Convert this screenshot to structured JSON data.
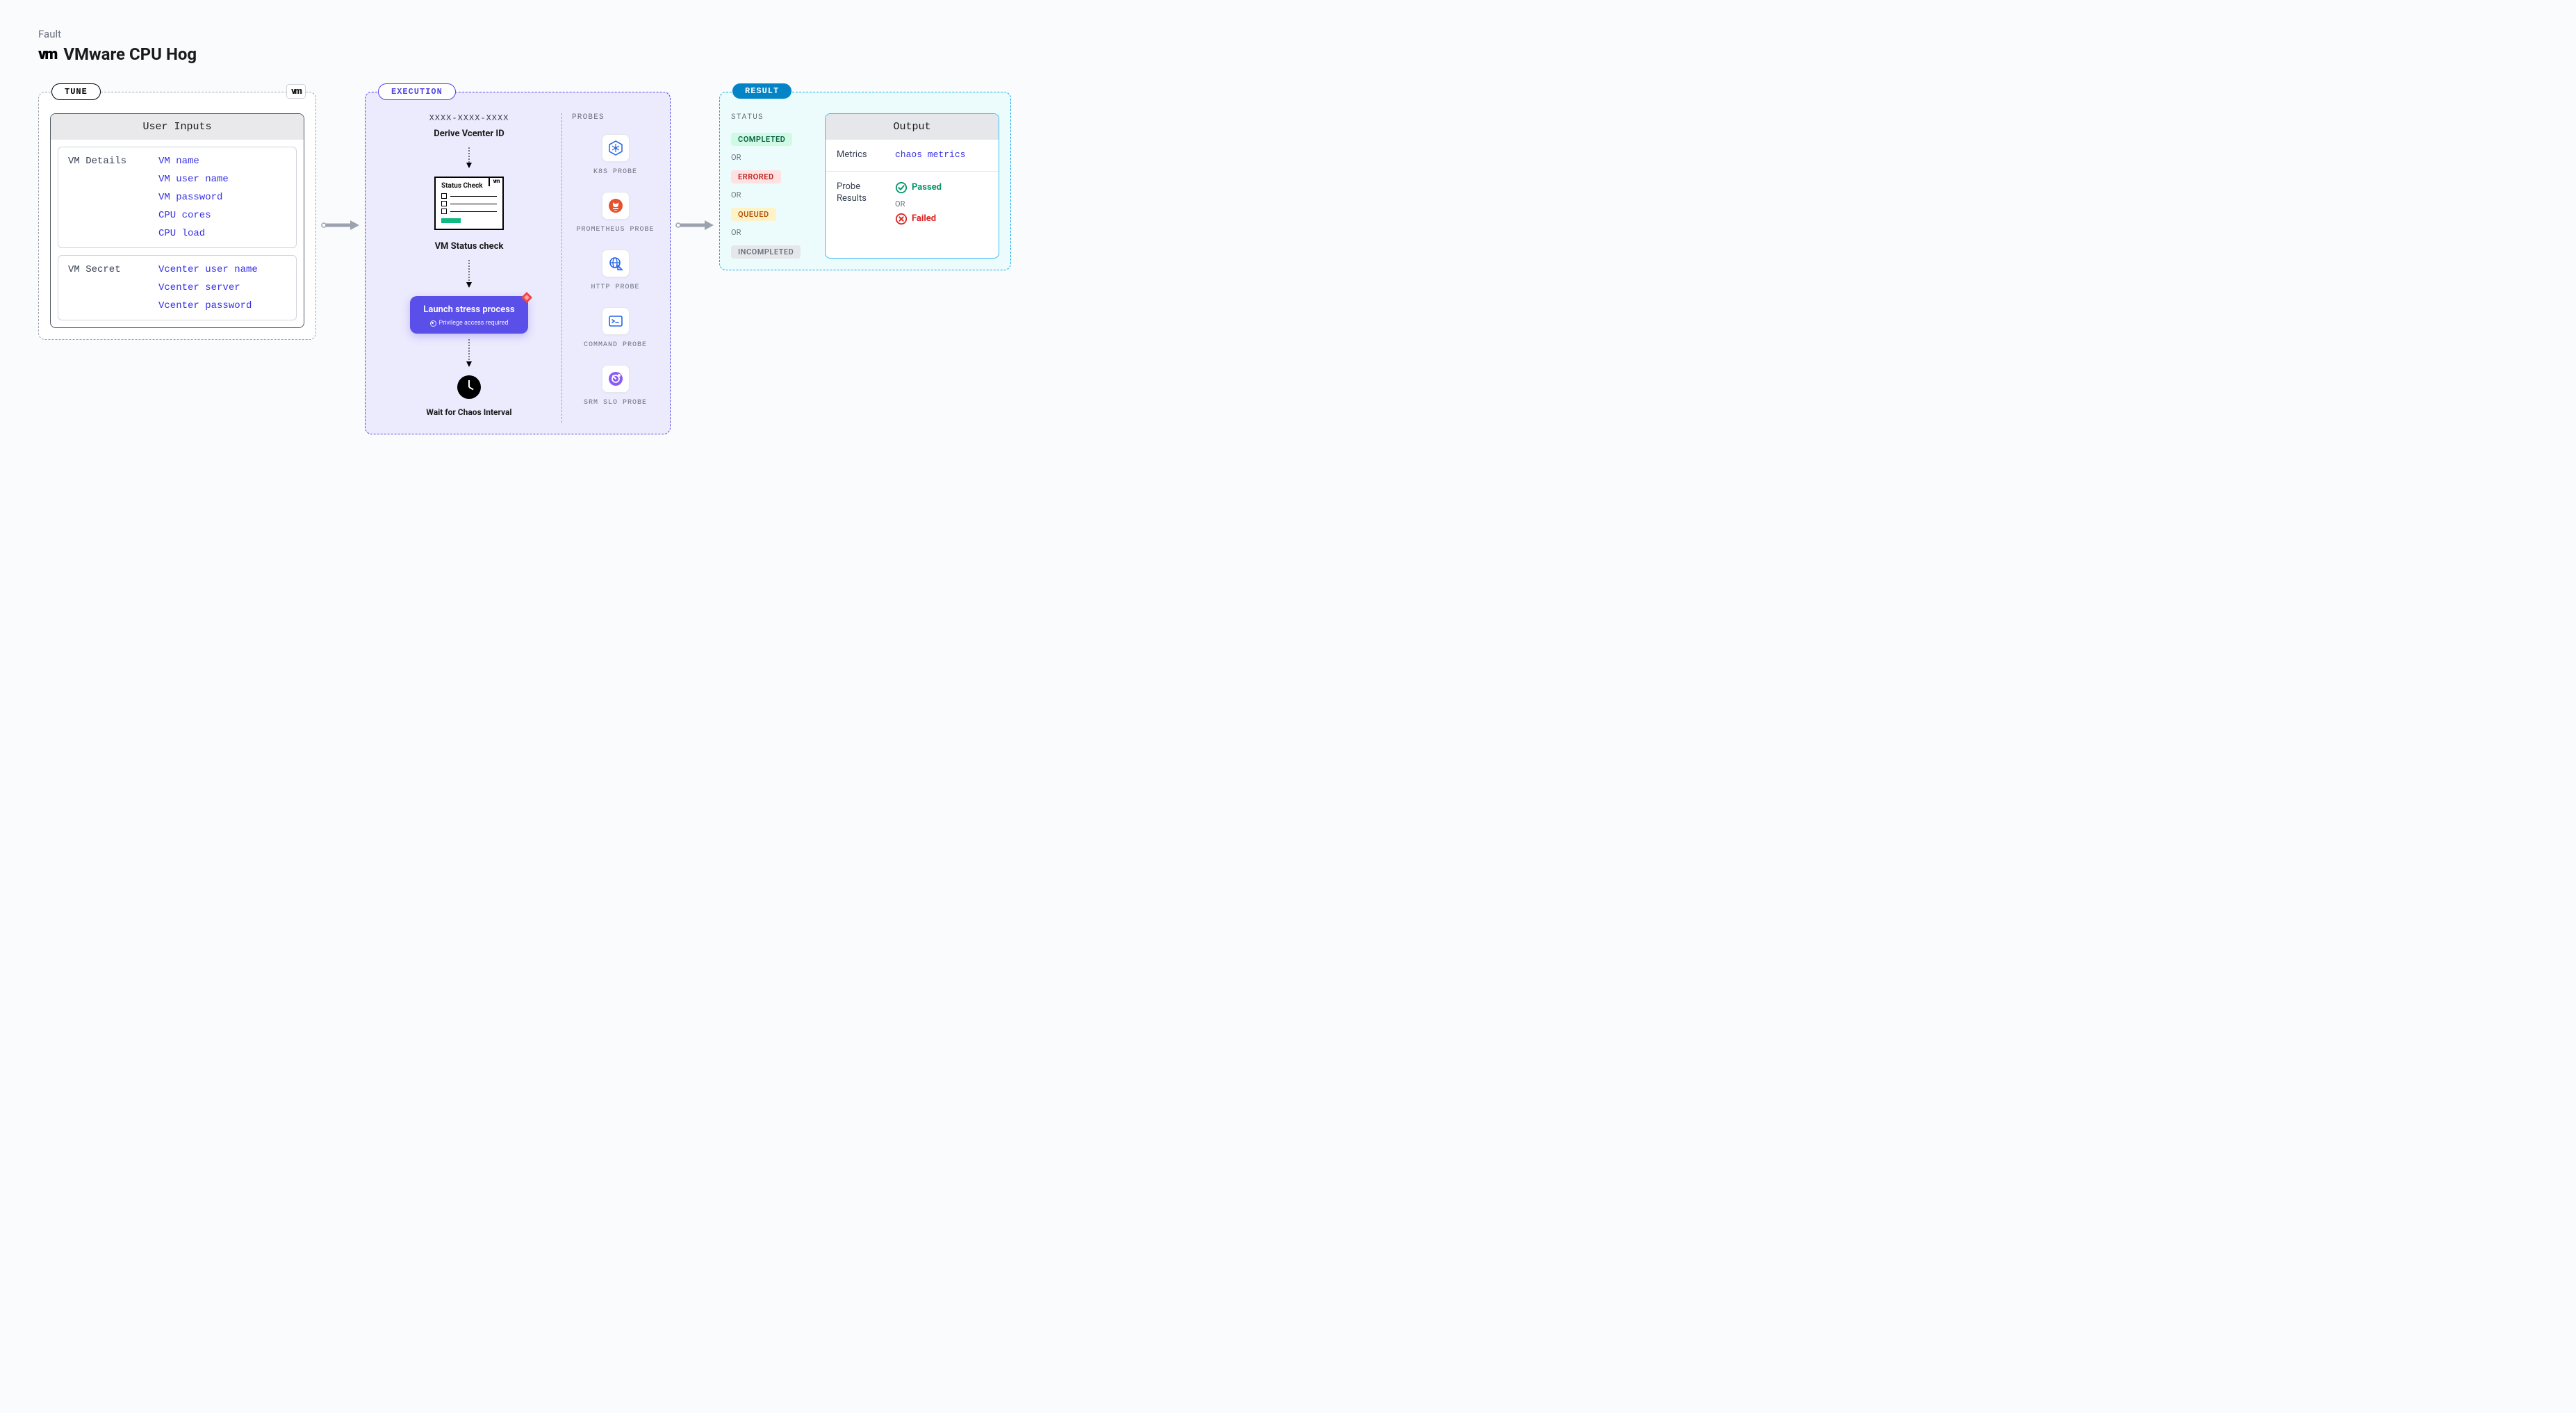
{
  "header": {
    "category": "Fault",
    "logo_text": "vm",
    "title": "VMware CPU Hog"
  },
  "tune": {
    "badge": "TUNE",
    "chip": "vm",
    "card_title": "User Inputs",
    "sections": [
      {
        "label": "VM Details",
        "values": [
          "VM name",
          "VM user name",
          "VM password",
          "CPU cores",
          "CPU load"
        ]
      },
      {
        "label": "VM Secret",
        "values": [
          "Vcenter user name",
          "Vcenter server",
          "Vcenter password"
        ]
      }
    ]
  },
  "execution": {
    "badge": "EXECUTION",
    "vcenter_id_placeholder": "XXXX-XXXX-XXXX",
    "step1_title": "Derive Vcenter ID",
    "status_card_title": "Status Check",
    "status_chip": "vm",
    "step2_title": "VM Status check",
    "stress_title": "Launch stress process",
    "stress_sub": "Privilege access required",
    "wait_title": "Wait for Chaos Interval",
    "probes_heading": "PROBES",
    "probes": [
      {
        "label": "K8S PROBE",
        "icon": "k8s"
      },
      {
        "label": "PROMETHEUS PROBE",
        "icon": "prometheus"
      },
      {
        "label": "HTTP PROBE",
        "icon": "http"
      },
      {
        "label": "COMMAND PROBE",
        "icon": "command"
      },
      {
        "label": "SRM SLO PROBE",
        "icon": "slo"
      }
    ]
  },
  "result": {
    "badge": "RESULT",
    "status_heading": "STATUS",
    "statuses": [
      {
        "text": "COMPLETED",
        "cls": "completed"
      },
      {
        "text": "ERRORED",
        "cls": "errored"
      },
      {
        "text": "QUEUED",
        "cls": "queued"
      },
      {
        "text": "INCOMPLETED",
        "cls": "incompleted"
      }
    ],
    "or": "OR",
    "output_title": "Output",
    "metrics_label": "Metrics",
    "metrics_value": "chaos metrics",
    "probe_results_label": "Probe Results",
    "passed": "Passed",
    "failed": "Failed"
  }
}
